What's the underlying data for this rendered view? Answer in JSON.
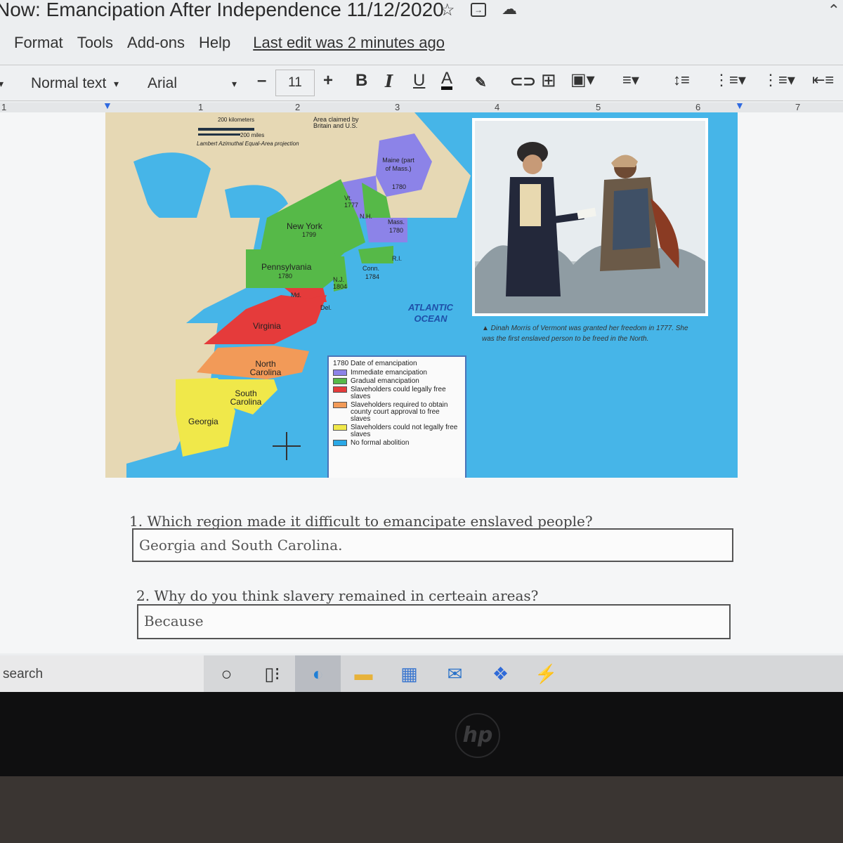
{
  "document": {
    "title": "Now: Emancipation After Independence 11/12/2020",
    "menu": [
      "Format",
      "Tools",
      "Add-ons",
      "Help"
    ],
    "last_edit": "Last edit was 2 minutes ago"
  },
  "toolbar": {
    "style": "Normal text",
    "font": "Arial",
    "minus": "–",
    "font_size": "11",
    "plus": "+",
    "bold": "B",
    "italic": "I",
    "underline": "U",
    "text_color": "A"
  },
  "ruler": [
    "1",
    "1",
    "2",
    "3",
    "4",
    "5",
    "6",
    "7"
  ],
  "map": {
    "scale_top": "200 kilometers",
    "scale_miles": "200 miles",
    "projection": "Lambert Azimuthal Equal-Area projection",
    "claimed": "Area claimed by Britain and U.S.",
    "ocean": "ATLANTIC OCEAN",
    "states": [
      {
        "name": "Maine (part of Mass.)",
        "year": "1780"
      },
      {
        "name": "Vt.",
        "year": "1777"
      },
      {
        "name": "N.H.",
        "year": ""
      },
      {
        "name": "Mass.",
        "year": "1780"
      },
      {
        "name": "New York",
        "year": "1799"
      },
      {
        "name": "R.I.",
        "year": ""
      },
      {
        "name": "Conn.",
        "year": "1784"
      },
      {
        "name": "Pennsylvania",
        "year": "1780"
      },
      {
        "name": "N.J.",
        "year": "1804"
      },
      {
        "name": "Md.",
        "year": ""
      },
      {
        "name": "Del.",
        "year": ""
      },
      {
        "name": "Virginia",
        "year": ""
      },
      {
        "name": "North Carolina",
        "year": ""
      },
      {
        "name": "South Carolina",
        "year": ""
      },
      {
        "name": "Georgia",
        "year": ""
      }
    ],
    "legend": {
      "heading": "1780 Date of emancipation",
      "items": [
        {
          "label": "Immediate emancipation",
          "color": "#8c83e8"
        },
        {
          "label": "Gradual emancipation",
          "color": "#56b948"
        },
        {
          "label": "Slaveholders could legally free slaves",
          "color": "#e53b3b"
        },
        {
          "label": "Slaveholders required to obtain county court approval to free slaves",
          "color": "#f29a58"
        },
        {
          "label": "Slaveholders could not legally free slaves",
          "color": "#f0e84a"
        },
        {
          "label": "No formal abolition",
          "color": "#2aa8e6"
        }
      ]
    },
    "caption": "▲ Dinah Morris of Vermont was granted her freedom in 1777. She was the first enslaved person to be freed in the North."
  },
  "questions": [
    {
      "label": "1.  Which region made it difficult to emancipate enslaved people?",
      "answer": "Georgia and South Carolina."
    },
    {
      "label": "2.  Why do you think slavery remained in certeain areas?",
      "answer": "Because"
    }
  ],
  "taskbar": {
    "search": "search",
    "icons": [
      "cortana-icon",
      "task-view-icon",
      "edge-icon",
      "file-explorer-icon",
      "store-icon",
      "mail-icon",
      "dropbox-icon",
      "app-icon"
    ]
  }
}
